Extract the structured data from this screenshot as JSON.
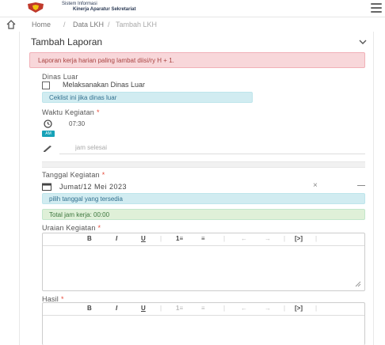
{
  "app": {
    "title_line1": "Sistem Informasi",
    "title_line2": "Kinerja Aparatur Sekretariat"
  },
  "breadcrumb": {
    "items": [
      "Home",
      "Data LKH",
      "Tambah LKH"
    ],
    "separator": "/"
  },
  "card": {
    "title": "Tambah Laporan",
    "alert_danger": "Laporan kerja harian paling lambat diisi/ry H + 1."
  },
  "form": {
    "dinas_luar": {
      "label": "Dinas Luar",
      "checkbox_label": "Melaksanakan Dinas Luar",
      "hint": "Ceklist ini jika dinas luar"
    },
    "waktu": {
      "label": "Waktu Kegiatan",
      "required_mark": "*",
      "value": "07:30",
      "badge": "AM",
      "jam_placeholder": "jam selesai"
    },
    "tanggal": {
      "label": "Tanggal Kegiatan",
      "required_mark": "*",
      "value": "Jumat/12 Mei 2023",
      "clear_symbol": "×",
      "hint": "pilih tanggal yang tersedia",
      "total": "Total jam kerja: 00:00"
    },
    "uraian": {
      "label": "Uraian Kegiatan",
      "required_mark": "*"
    },
    "hasil": {
      "label": "Hasil",
      "required_mark": "*"
    }
  },
  "toolbar": {
    "bold": "B",
    "italic": "I",
    "underline": "U",
    "ordered_list": "1≡",
    "bullet_list": "≡",
    "undo": "←",
    "redo": "→",
    "source": "[>]",
    "separator": "|"
  },
  "colors": {
    "danger_bg": "#f8d7da",
    "info_bg": "#d1ecf1",
    "success_bg": "#dff0d8",
    "badge_bg": "#17a2b8",
    "required": "#e74c3c"
  }
}
